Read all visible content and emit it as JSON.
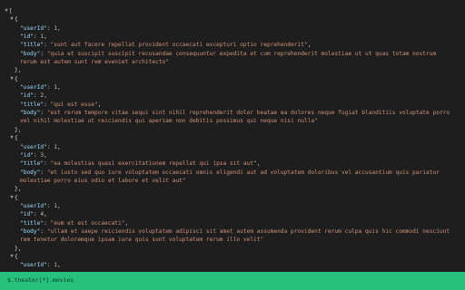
{
  "viewer": {
    "root_open": "[",
    "objects": [
      {
        "userId": "1",
        "id": "1",
        "title": "\"sunt aut facere repellat provident occaecati excepturi optio reprehenderit\"",
        "body": "\"quia et suscipit suscipit recusandae consequuntur expedita et cum reprehenderit molestiae ut ut quas totam nostrum rerum est autem sunt rem eveniet architecto\""
      },
      {
        "userId": "1",
        "id": "2",
        "title": "\"qui est esse\"",
        "body": "\"est rerum tempore vitae sequi sint nihil reprehenderit dolor beatae ea dolores neque fugiat blanditiis voluptate porro vel nihil molestiae ut reiciendis qui aperiam non debitis possimus qui neque nisi nulla\""
      },
      {
        "userId": "1",
        "id": "3",
        "title": "\"ea molestias quasi exercitationem repellat qui ipsa sit aut\"",
        "body": "\"et iusto sed quo iure voluptatem occaecati omnis eligendi aut ad voluptatem doloribus vel accusantium quis pariatur molestiae porro eius odio et labore et velit aut\""
      },
      {
        "userId": "1",
        "id": "4",
        "title": "\"eum et est occaecati\"",
        "body": "\"ullam et saepe reiciendis voluptatem adipisci sit amet autem assumenda provident rerum culpa quis hic commodi nesciunt rem tenetur doloremque ipsam iure quis sunt voluptatem rerum illo velit\""
      }
    ],
    "partial": {
      "userId": "1"
    },
    "keys": {
      "userId": "\"userId\"",
      "id": "\"id\"",
      "title": "\"title\"",
      "body": "\"body\""
    },
    "punct": {
      "obj_open": "{",
      "obj_close": "},",
      "colon": ": ",
      "comma": ","
    },
    "toggle_icon": "chevron-down"
  },
  "status": {
    "path": "$.theater[*].movies"
  },
  "colors": {
    "background": "#1e1e1e",
    "key": "#9cdcfe",
    "string": "#ce9178",
    "number": "#b5cea8",
    "status_bar": "#25c07a"
  }
}
